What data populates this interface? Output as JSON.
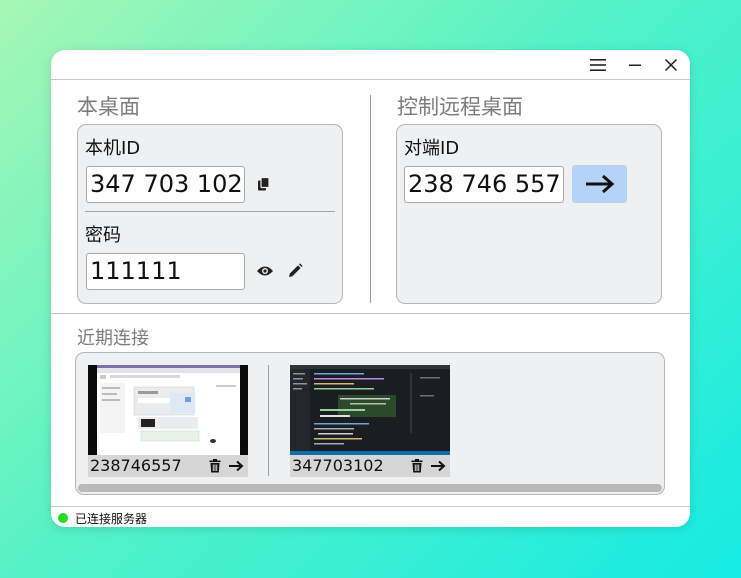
{
  "colors": {
    "status_ok": "#22dd22",
    "connect_button": "#b5d3f6",
    "panel_bg": "#eff0f2"
  },
  "titlebar": {
    "icons": [
      "menu-icon",
      "minimize-icon",
      "close-icon"
    ]
  },
  "local": {
    "section_title": "本桌面",
    "id_label": "本机ID",
    "id_value": "347 703 102",
    "password_label": "密码",
    "password_value": "111111",
    "icons": [
      "copy-icon",
      "eye-icon",
      "pencil-icon"
    ]
  },
  "remote": {
    "section_title": "控制远程桌面",
    "id_label": "对端ID",
    "id_value": "238 746 557",
    "connect_icon": "arrow-right-icon"
  },
  "recent": {
    "title": "近期连接",
    "items": [
      {
        "id": "238746557",
        "icons": [
          "trash-icon",
          "arrow-right-icon"
        ]
      },
      {
        "id": "347703102",
        "icons": [
          "trash-icon",
          "arrow-right-icon"
        ]
      }
    ]
  },
  "status": {
    "text": "已连接服务器"
  }
}
